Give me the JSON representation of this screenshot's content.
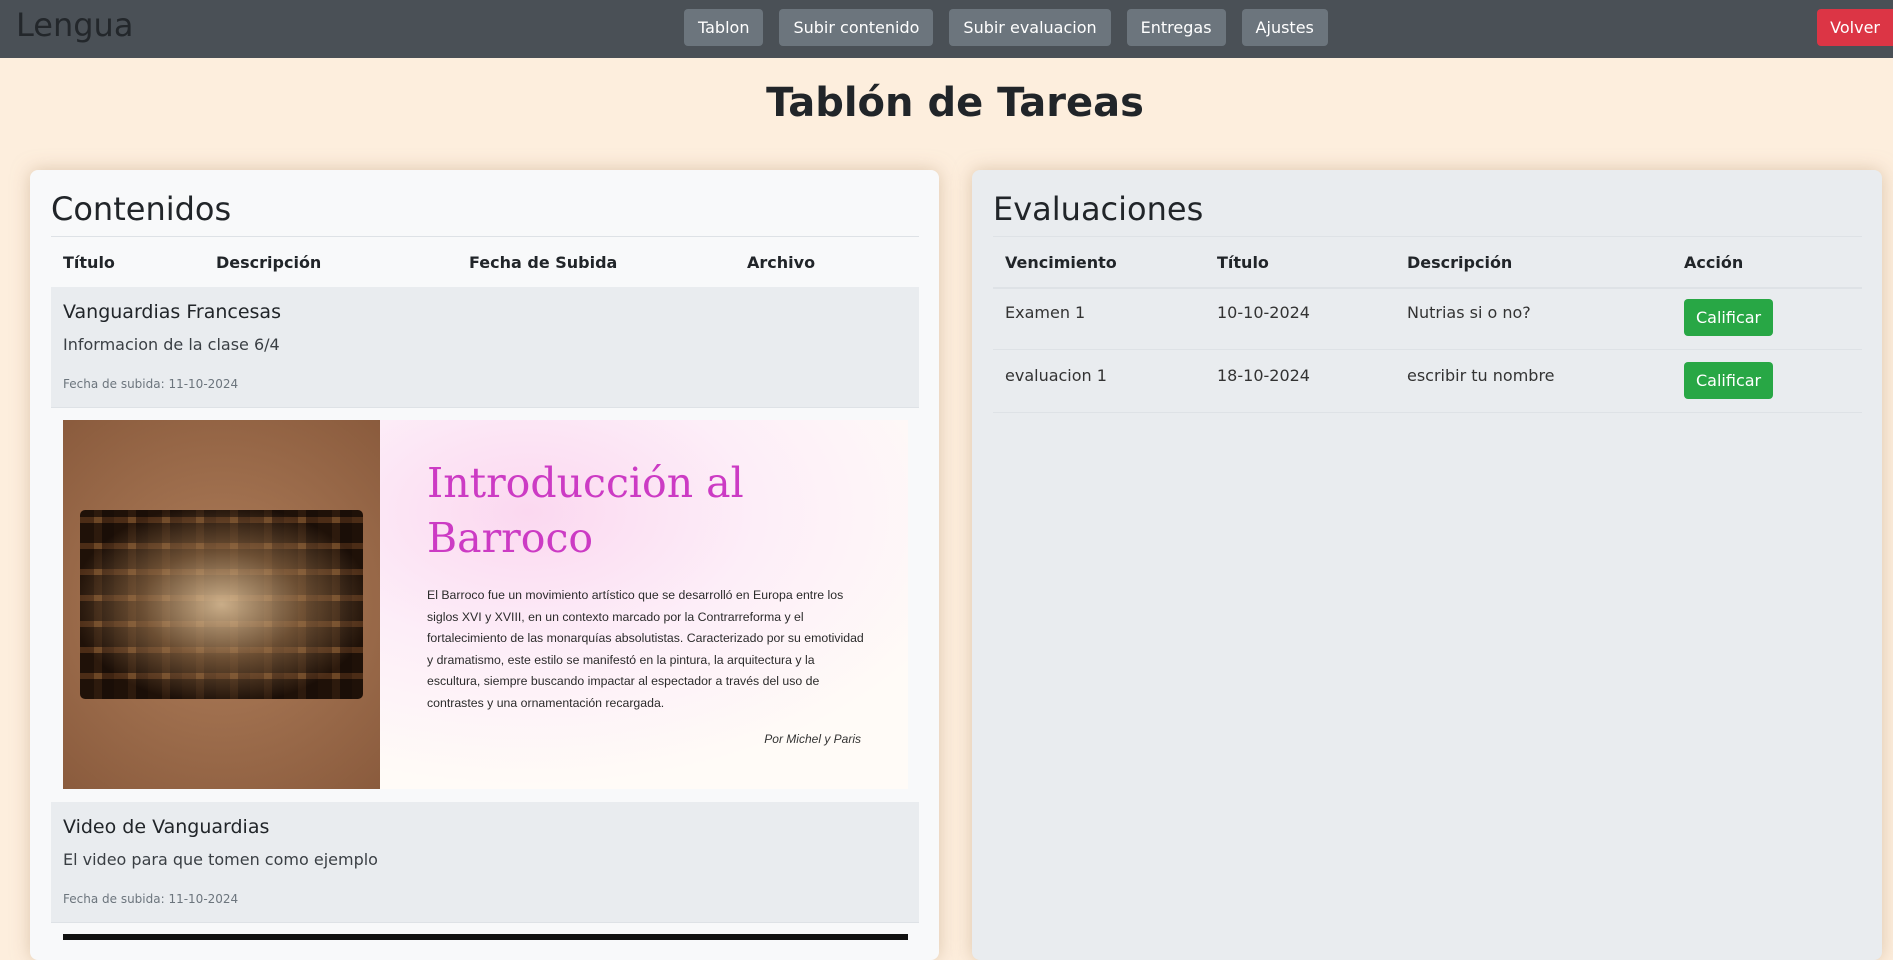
{
  "nav": {
    "brand": "Lengua",
    "buttons": [
      "Tablon",
      "Subir contenido",
      "Subir evaluacion",
      "Entregas",
      "Ajustes"
    ],
    "back": "Volver"
  },
  "page_title": "Tablón de Tareas",
  "contenidos": {
    "heading": "Contenidos",
    "columns": [
      "Título",
      "Descripción",
      "Fecha de Subida",
      "Archivo"
    ],
    "items": [
      {
        "title": "Vanguardias Francesas",
        "description": "Informacion de la clase 6/4",
        "date": "Fecha de subida: 11-10-2024"
      },
      {
        "title": "Video de Vanguardias",
        "description": "El video para que tomen como ejemplo",
        "date": "Fecha de subida: 11-10-2024"
      }
    ],
    "slide": {
      "title": "Introducción al Barroco",
      "body": "El Barroco fue un movimiento artístico que se desarrolló en Europa entre los siglos XVI y XVIII, en un contexto marcado por la Contrarreforma y el fortalecimiento de las monarquías absolutistas. Caracterizado por su emotividad y dramatismo, este estilo se manifestó en la pintura, la arquitectura y la escultura, siempre buscando impactar al espectador a través del uso de contrastes y una ornamentación recargada.",
      "author": "Por Michel y Paris"
    }
  },
  "evaluaciones": {
    "heading": "Evaluaciones",
    "columns": [
      "Vencimiento",
      "Título",
      "Descripción",
      "Acción"
    ],
    "rows": [
      {
        "col1": "Examen 1",
        "col2": "10-10-2024",
        "col3": "Nutrias si o no?",
        "action": "Calificar"
      },
      {
        "col1": "evaluacion 1",
        "col2": "18-10-2024",
        "col3": "escribir tu nombre",
        "action": "Calificar"
      }
    ]
  }
}
